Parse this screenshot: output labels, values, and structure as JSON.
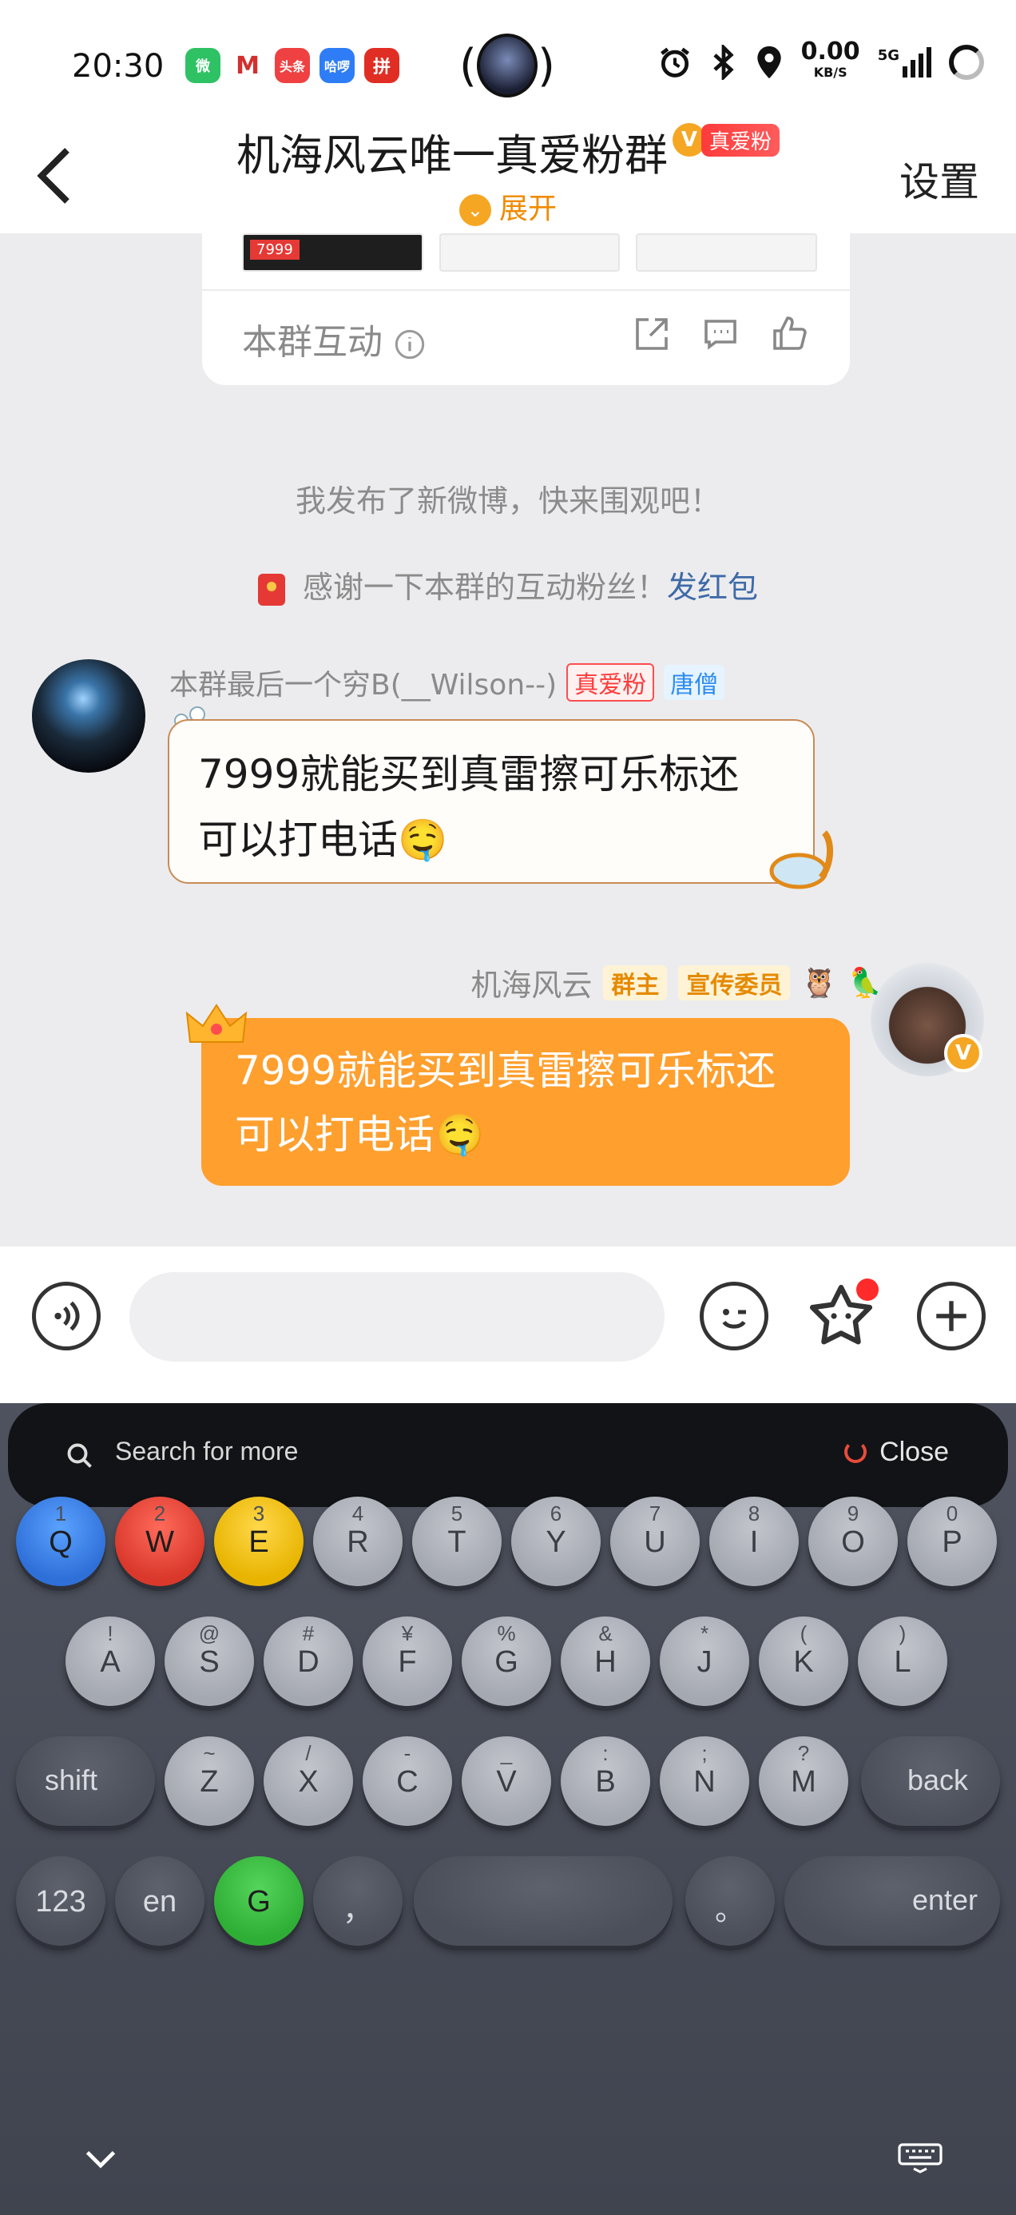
{
  "status_bar": {
    "time": "20:30",
    "apps": [
      "wechat-icon",
      "merchants-bank-icon",
      "toutiao-icon",
      "hellobike-icon",
      "pinduoduo-icon"
    ],
    "app_labels": [
      "微",
      "M",
      "头条",
      "哈啰",
      "拼"
    ],
    "network_speed": "0.00",
    "network_unit": "KB/S",
    "network_type": "5G"
  },
  "header": {
    "back_icon": "chevron-left-icon",
    "title": "机海风云唯一真爱粉群",
    "title_badge": "真爱粉",
    "expand_label": "展开",
    "settings_label": "设置"
  },
  "card": {
    "price_tag": "7999",
    "label": "本群互动",
    "icons": [
      "share-icon",
      "comment-icon",
      "like-icon"
    ]
  },
  "system_messages": {
    "weibo_notice": "我发布了新微博，快来围观吧！",
    "thanks_text": "感谢一下本群的互动粉丝！",
    "red_packet_link": "发红包"
  },
  "messages": [
    {
      "sender": "本群最后一个穷B(__Wilson--)",
      "tags": [
        "真爱粉",
        "唐僧"
      ],
      "text_line1": "7999就能买到真雷擦可乐标还",
      "text_line2": "可以打电话"
    },
    {
      "sender": "机海风云",
      "tags": [
        "群主",
        "宣传委员"
      ],
      "text_line1": "7999就能买到真雷擦可乐标还",
      "text_line2": "可以打电话"
    }
  ],
  "input_bar": {
    "voice_icon": "voice-icon",
    "emoji_icon": "emoji-icon",
    "sticker_icon": "sticker-icon",
    "plus_icon": "plus-icon"
  },
  "keyboard": {
    "search_placeholder": "Search for more",
    "close_label": "Close",
    "row1": [
      {
        "k": "Q",
        "s": "1"
      },
      {
        "k": "W",
        "s": "2"
      },
      {
        "k": "E",
        "s": "3"
      },
      {
        "k": "R",
        "s": "4"
      },
      {
        "k": "T",
        "s": "5"
      },
      {
        "k": "Y",
        "s": "6"
      },
      {
        "k": "U",
        "s": "7"
      },
      {
        "k": "I",
        "s": "8"
      },
      {
        "k": "O",
        "s": "9"
      },
      {
        "k": "P",
        "s": "0"
      }
    ],
    "row2": [
      {
        "k": "A",
        "s": "!"
      },
      {
        "k": "S",
        "s": "@"
      },
      {
        "k": "D",
        "s": "#"
      },
      {
        "k": "F",
        "s": "¥"
      },
      {
        "k": "G",
        "s": "%"
      },
      {
        "k": "H",
        "s": "&"
      },
      {
        "k": "J",
        "s": "*"
      },
      {
        "k": "K",
        "s": "("
      },
      {
        "k": "L",
        "s": ")"
      }
    ],
    "row3": [
      {
        "k": "Z",
        "s": "~"
      },
      {
        "k": "X",
        "s": "/"
      },
      {
        "k": "C",
        "s": "-"
      },
      {
        "k": "V",
        "s": "_"
      },
      {
        "k": "B",
        "s": ":"
      },
      {
        "k": "N",
        "s": ";"
      },
      {
        "k": "M",
        "s": "?"
      }
    ],
    "shift_label": "shift",
    "back_label": "back",
    "num_label": "123",
    "lang_label": "en",
    "g_label": "G",
    "comma_label": "，",
    "period_label": "。",
    "enter_label": "enter",
    "collapse_icon": "chevron-down-icon",
    "keyboard_switch_icon": "keyboard-icon"
  }
}
